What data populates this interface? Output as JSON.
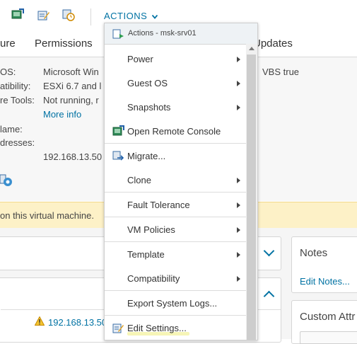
{
  "toolbar": {
    "icons": [
      "console-icon",
      "edit-settings-icon",
      "vm-clock-icon"
    ],
    "actions_label": "ACTIONS"
  },
  "tabs": {
    "partial_left": "ure",
    "permissions": "Permissions",
    "updates": "Updates"
  },
  "summary": {
    "rows": [
      {
        "label": "OS:",
        "value": "Microsoft Win"
      },
      {
        "label": "atibility:",
        "value": "ESXi 6.7 and l"
      },
      {
        "label": "re Tools:",
        "value": "Not running, r"
      },
      {
        "label": "",
        "value": "More info"
      },
      {
        "label": "lame:",
        "value": ""
      },
      {
        "label": "dresses:",
        "value": ""
      },
      {
        "label": "",
        "value": "192.168.13.50"
      }
    ],
    "vbs": "VBS true"
  },
  "banner": {
    "text": "on this virtual machine."
  },
  "lower": {
    "notes_title": "Notes",
    "edit_notes": "Edit Notes...",
    "custom_attr_title": "Custom Attr",
    "ip_link": "192.168.13.50"
  },
  "menu": {
    "header": "Actions - msk-srv01",
    "items": [
      {
        "label": "Power",
        "submenu": true,
        "icon": ""
      },
      {
        "label": "Guest OS",
        "submenu": true,
        "icon": ""
      },
      {
        "label": "Snapshots",
        "submenu": true,
        "icon": ""
      },
      {
        "label": "Open Remote Console",
        "submenu": false,
        "icon": "remote-console-icon"
      },
      {
        "label": "Migrate...",
        "submenu": false,
        "icon": "migrate-icon"
      },
      {
        "label": "Clone",
        "submenu": true,
        "icon": ""
      },
      {
        "label": "Fault Tolerance",
        "submenu": true,
        "icon": ""
      },
      {
        "label": "VM Policies",
        "submenu": true,
        "icon": ""
      },
      {
        "label": "Template",
        "submenu": true,
        "icon": ""
      },
      {
        "label": "Compatibility",
        "submenu": true,
        "icon": ""
      },
      {
        "label": "Export System Logs...",
        "submenu": false,
        "icon": ""
      },
      {
        "label": "Edit Settings...",
        "submenu": false,
        "icon": "edit-settings-icon"
      }
    ]
  },
  "colors": {
    "accent": "#0072a3",
    "banner": "#fdf1c7",
    "menu_header": "#eef2f5"
  }
}
